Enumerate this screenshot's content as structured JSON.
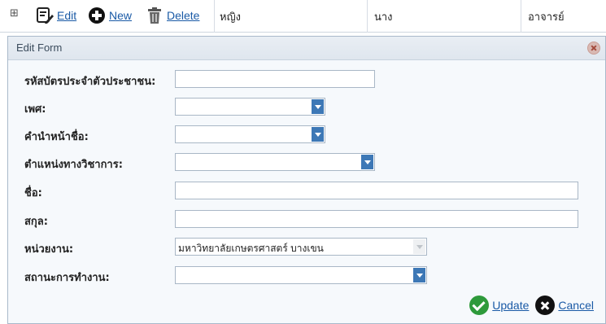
{
  "row": {
    "expand": "⊞",
    "edit_label": "Edit",
    "new_label": "New",
    "delete_label": "Delete",
    "cells": [
      "หญิง",
      "นาง",
      "อาจารย์"
    ]
  },
  "form": {
    "title": "Edit Form",
    "fields": {
      "citizen_id": {
        "label": "รหัสบัตรประจำตัวประชาชน:",
        "value": ""
      },
      "gender": {
        "label": "เพศ:",
        "value": ""
      },
      "prefix": {
        "label": "คำนำหน้าชื่อ:",
        "value": ""
      },
      "academic_position": {
        "label": "ตำแหน่งทางวิชาการ:",
        "value": ""
      },
      "first_name": {
        "label": "ชื่อ:",
        "value": ""
      },
      "last_name": {
        "label": "สกุล:",
        "value": ""
      },
      "department": {
        "label": "หน่วยงาน:",
        "value": "มหาวิทยาลัยเกษตรศาสตร์ บางเขน"
      },
      "work_status": {
        "label": "สถานะการทำงาน:",
        "value": ""
      }
    },
    "update_label": "Update",
    "cancel_label": "Cancel"
  },
  "colors": {
    "accent": "#3d78b6",
    "link": "#1a5aa6",
    "ok": "#2e9a3b"
  }
}
